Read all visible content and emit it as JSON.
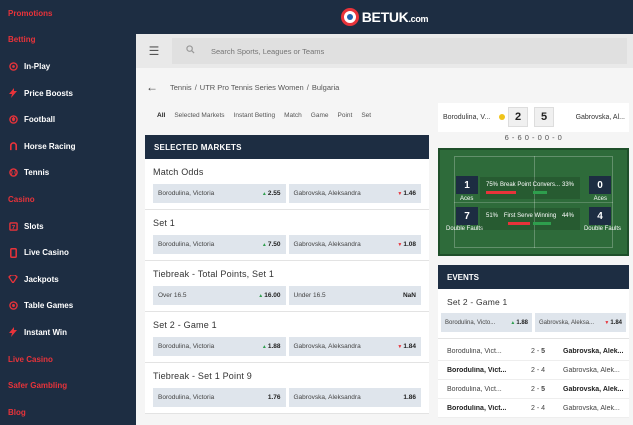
{
  "sidebar": {
    "items": [
      {
        "label": "Promotions",
        "type": "section",
        "icon": ""
      },
      {
        "label": "Betting",
        "type": "section",
        "icon": ""
      },
      {
        "label": "In-Play",
        "type": "item",
        "icon": "live-icon"
      },
      {
        "label": "Price Boosts",
        "type": "item",
        "icon": "bolt-icon"
      },
      {
        "label": "Football",
        "type": "item",
        "icon": "football-icon"
      },
      {
        "label": "Horse Racing",
        "type": "item",
        "icon": "horseshoe-icon"
      },
      {
        "label": "Tennis",
        "type": "item",
        "icon": "tennis-ball-icon"
      },
      {
        "label": "Casino",
        "type": "section",
        "icon": ""
      },
      {
        "label": "Slots",
        "type": "item",
        "icon": "slot-icon"
      },
      {
        "label": "Live Casino",
        "type": "item",
        "icon": "phone-icon"
      },
      {
        "label": "Jackpots",
        "type": "item",
        "icon": "diamond-icon"
      },
      {
        "label": "Table Games",
        "type": "item",
        "icon": "chip-icon"
      },
      {
        "label": "Instant Win",
        "type": "item",
        "icon": "bolt-icon"
      },
      {
        "label": "Live Casino",
        "type": "section",
        "icon": ""
      },
      {
        "label": "Safer Gambling",
        "type": "section",
        "icon": ""
      },
      {
        "label": "Blog",
        "type": "section",
        "icon": ""
      }
    ]
  },
  "header": {
    "logo_text": "BETUK",
    "logo_suffix": ".com"
  },
  "search": {
    "placeholder": "Search Sports, Leagues or Teams"
  },
  "breadcrumb": {
    "items": [
      "Tennis",
      "UTR Pro Tennis Series Women",
      "Bulgaria"
    ]
  },
  "tabs": [
    "All",
    "Selected Markets",
    "Instant Betting",
    "Match",
    "Game",
    "Point",
    "Set"
  ],
  "selected_markets": {
    "title": "SELECTED MARKETS",
    "markets": [
      {
        "title": "Match Odds",
        "odds": [
          {
            "label": "Borodulina, Victoria",
            "value": "2.55",
            "trend": "up"
          },
          {
            "label": "Gabrovska, Aleksandra",
            "value": "1.46",
            "trend": "down"
          }
        ]
      },
      {
        "title": "Set 1",
        "odds": [
          {
            "label": "Borodulina, Victoria",
            "value": "7.50",
            "trend": "up"
          },
          {
            "label": "Gabrovska, Aleksandra",
            "value": "1.08",
            "trend": "down"
          }
        ]
      },
      {
        "title": "Tiebreak - Total Points, Set 1",
        "odds": [
          {
            "label": "Over 16.5",
            "value": "16.00",
            "trend": "up"
          },
          {
            "label": "Under 16.5",
            "value": "NaN",
            "trend": ""
          }
        ]
      },
      {
        "title": "Set 2 - Game 1",
        "odds": [
          {
            "label": "Borodulina, Victoria",
            "value": "1.88",
            "trend": "up"
          },
          {
            "label": "Gabrovska, Aleksandra",
            "value": "1.84",
            "trend": "down"
          }
        ]
      },
      {
        "title": "Tiebreak - Set 1 Point 9",
        "odds": [
          {
            "label": "Borodulina, Victoria",
            "value": "1.76",
            "trend": ""
          },
          {
            "label": "Gabrovska, Aleksandra",
            "value": "1.86",
            "trend": ""
          }
        ]
      }
    ]
  },
  "scoreboard": {
    "player1": "Borodulina, V...",
    "player2": "Gabrovska, Al...",
    "score1": "2",
    "score2": "5",
    "set_scores": "6 - 6   0 - 0   0 - 0",
    "colors": {
      "serve_dot": "#f0c419",
      "court": "#2e6b3a"
    }
  },
  "stats": {
    "aces_left": "1",
    "aces_right": "0",
    "aces_label": "Aces",
    "df_left": "7",
    "df_right": "4",
    "df_label": "Double Faults",
    "bp_left": "75%",
    "bp_label": "Break Point Convers...",
    "bp_right": "33%",
    "fs_left": "51%",
    "fs_label": "First Serve Winning",
    "fs_right": "44%"
  },
  "events": {
    "title": "EVENTS",
    "market": {
      "title": "Set 2 - Game 1",
      "odds": [
        {
          "label": "Borodulina, Victo...",
          "value": "1.88",
          "trend": "up"
        },
        {
          "label": "Gabrovska, Aleksa...",
          "value": "1.84",
          "trend": "down"
        }
      ]
    },
    "points": [
      {
        "p1": "Borodulina, Vict...",
        "s1": "2",
        "s2": "5",
        "p2": "Gabrovska, Alek...",
        "p1_bold": false,
        "p2_bold": true
      },
      {
        "p1": "Borodulina, Vict...",
        "s1": "2",
        "s2": "4",
        "p2": "Gabrovska, Alek...",
        "p1_bold": true,
        "p2_bold": false
      },
      {
        "p1": "Borodulina, Vict...",
        "s1": "2",
        "s2": "5",
        "p2": "Gabrovska, Alek...",
        "p1_bold": false,
        "p2_bold": true
      },
      {
        "p1": "Borodulina, Vict...",
        "s1": "2",
        "s2": "4",
        "p2": "Gabrovska, Alek...",
        "p1_bold": true,
        "p2_bold": false
      }
    ]
  }
}
